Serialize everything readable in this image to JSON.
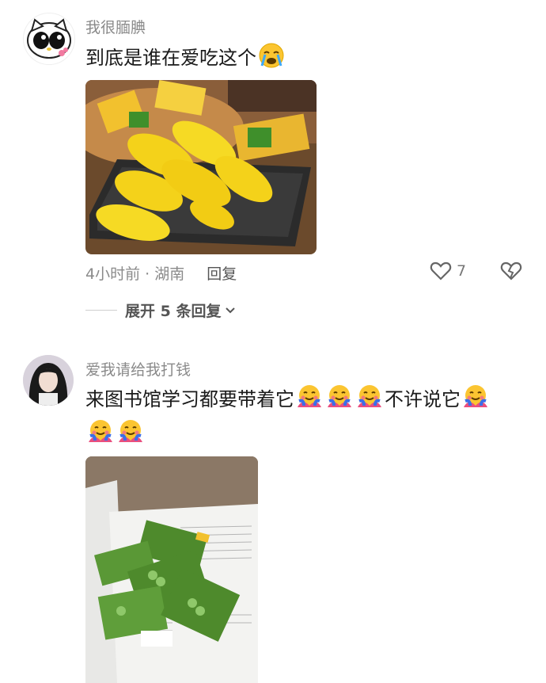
{
  "comments": [
    {
      "username": "我很腼腆",
      "text": "到底是谁在爱吃这个",
      "time_location": "4小时前 · 湖南",
      "reply_label": "回复",
      "likes": "7",
      "expand_label": "展开 5 条回复"
    },
    {
      "username": "爱我请给我打钱",
      "text_part1": "来图书馆学习都要带着它",
      "text_part2": "不许说它"
    }
  ],
  "icons": {
    "emoji1": "sobbing-face-icon",
    "emoji2": "hugging-face-icon",
    "like": "heart-outline-icon",
    "dislike": "broken-heart-icon",
    "expand": "chevron-down-icon"
  },
  "colors": {
    "meta_text": "#8a8a8a",
    "corn_yellow": "#f4d21a",
    "pea_green": "#4e8a2c"
  }
}
